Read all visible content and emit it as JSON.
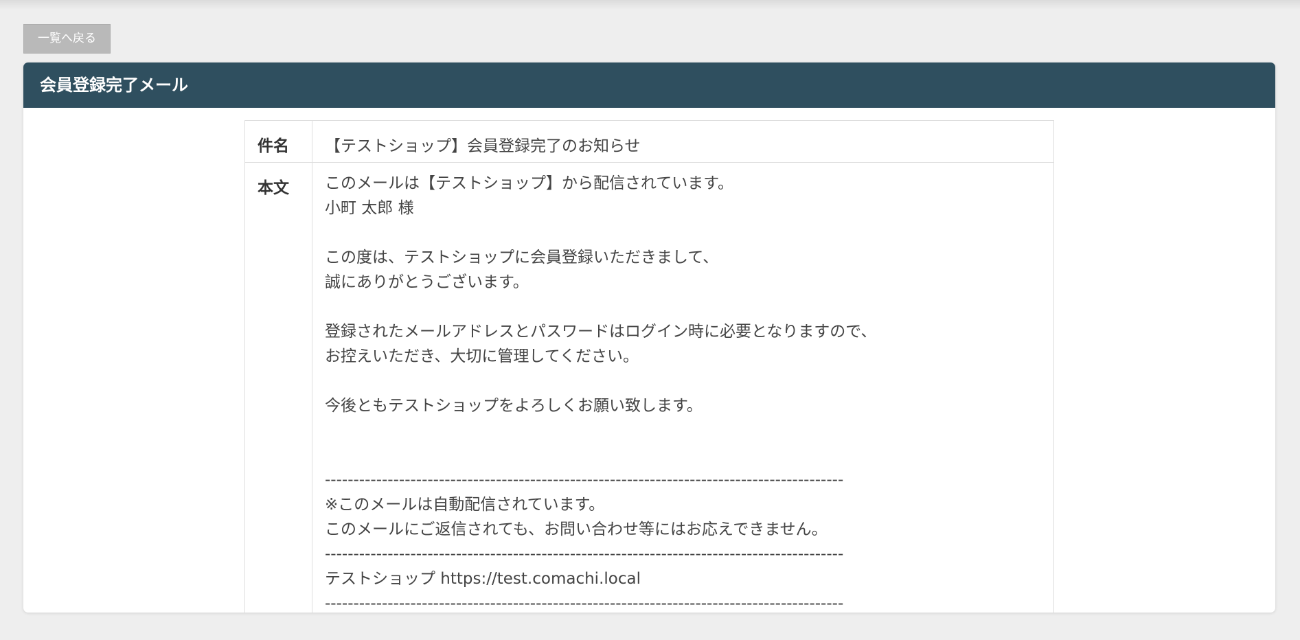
{
  "toolbar": {
    "back_label": "一覧へ戻る"
  },
  "panel": {
    "title": "会員登録完了メール"
  },
  "mail": {
    "subject_label": "件名",
    "subject_value": "【テストショップ】会員登録完了のお知らせ",
    "body_label": "本文",
    "body_value": "このメールは【テストショップ】から配信されています。\n小町 太郎 様\n\nこの度は、テストショップに会員登録いただきまして、\n誠にありがとうございます。\n\n登録されたメールアドレスとパスワードはログイン時に必要となりますので、\nお控えいただき、大切に管理してください。\n\n今後ともテストショップをよろしくお願い致します。\n\n\n-------------------------------------------------------------------------------------------\n※このメールは自動配信されています。\nこのメールにご返信されても、お問い合わせ等にはお応えできません。\n-------------------------------------------------------------------------------------------\nテストショップ https://test.comachi.local\n-------------------------------------------------------------------------------------------"
  },
  "colors": {
    "page_background": "#eeeeee",
    "header_background": "#2f4f5f",
    "back_button_background": "#b9b9b9"
  }
}
